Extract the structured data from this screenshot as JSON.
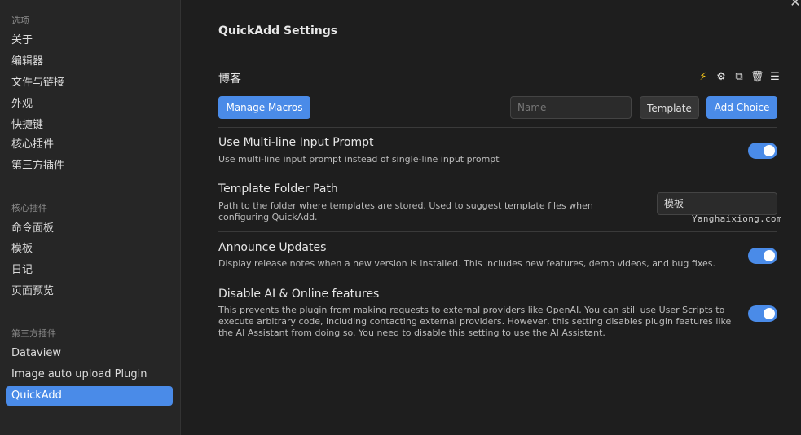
{
  "sidebar": {
    "sections": [
      {
        "title": "选项",
        "items": [
          "关于",
          "编辑器",
          "文件与链接",
          "外观",
          "快捷键",
          "核心插件",
          "第三方插件"
        ]
      },
      {
        "title": "核心插件",
        "items": [
          "命令面板",
          "模板",
          "日记",
          "页面预览"
        ]
      },
      {
        "title": "第三方插件",
        "items": [
          "Dataview",
          "Image auto upload Plugin",
          "QuickAdd"
        ]
      }
    ],
    "active_item": "QuickAdd"
  },
  "close_icon": "close-icon",
  "main": {
    "title": "QuickAdd Settings",
    "choice": {
      "name": "博客",
      "icons": [
        "lightning-icon",
        "gear-icon",
        "duplicate-icon",
        "trash-icon",
        "drag-handle-icon"
      ]
    },
    "toolbar": {
      "manage_macros_label": "Manage Macros",
      "name_placeholder": "Name",
      "template_label": "Template",
      "add_choice_label": "Add Choice"
    },
    "settings": [
      {
        "name": "Use Multi-line Input Prompt",
        "description": "Use multi-line input prompt instead of single-line input prompt",
        "type": "toggle",
        "enabled": true
      },
      {
        "name": "Template Folder Path",
        "description": "Path to the folder where templates are stored. Used to suggest template files when configuring QuickAdd.",
        "type": "text",
        "value": "模板"
      },
      {
        "name": "Announce Updates",
        "description": "Display release notes when a new version is installed. This includes new features, demo videos, and bug fixes.",
        "type": "toggle",
        "enabled": true
      },
      {
        "name": "Disable AI & Online features",
        "description": "This prevents the plugin from making requests to external providers like OpenAI. You can still use User Scripts to execute arbitrary code, including contacting external providers. However, this setting disables plugin features like the AI Assistant from doing so. You need to disable this setting to use the AI Assistant.",
        "type": "toggle",
        "enabled": true
      }
    ],
    "watermark": "Yanghaixiong.com"
  },
  "colors": {
    "accent": "#4a8be8",
    "background": "#1e1e1e",
    "sidebar": "#262626",
    "bolt": "#f5c518"
  }
}
